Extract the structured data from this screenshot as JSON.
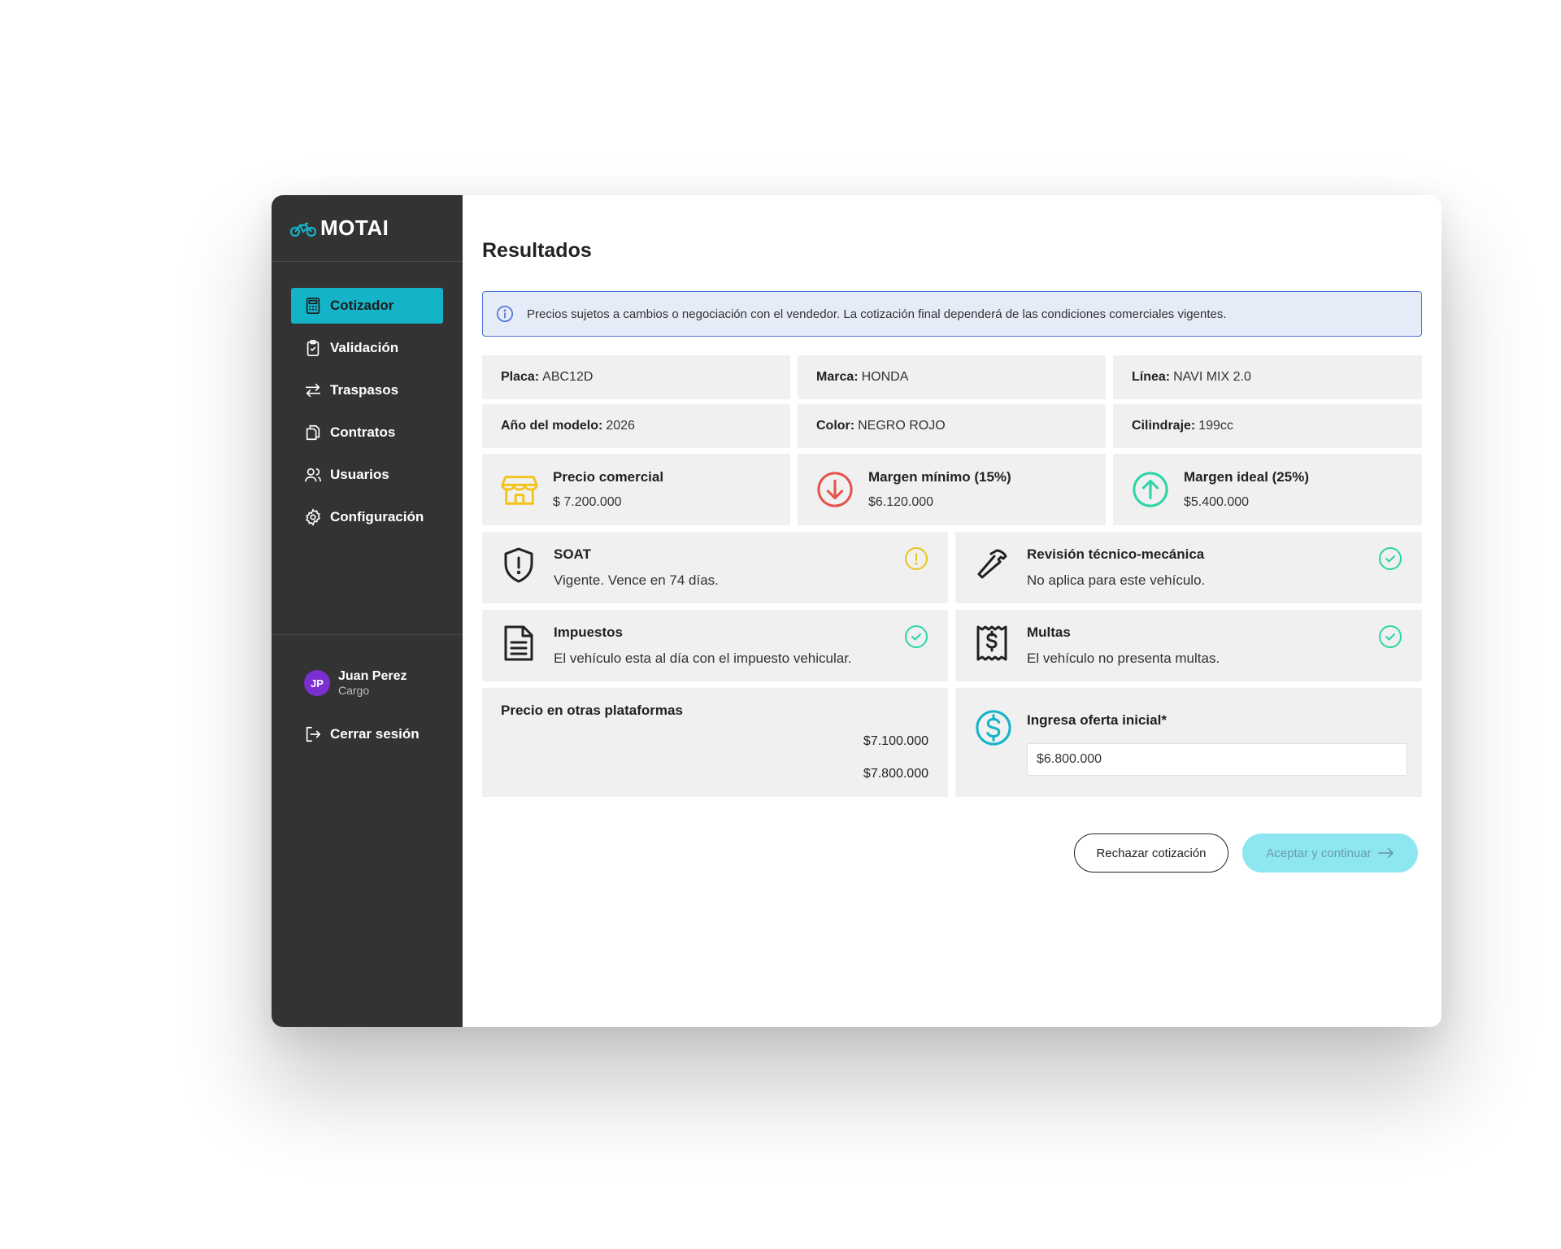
{
  "app": {
    "name": "MOTAI"
  },
  "sidebar": {
    "items": [
      {
        "label": "Cotizador",
        "active": true,
        "icon": "calculator-icon"
      },
      {
        "label": "Validación",
        "active": false,
        "icon": "clipboard-check-icon"
      },
      {
        "label": "Traspasos",
        "active": false,
        "icon": "arrows-swap-icon"
      },
      {
        "label": "Contratos",
        "active": false,
        "icon": "documents-icon"
      },
      {
        "label": "Usuarios",
        "active": false,
        "icon": "users-icon"
      },
      {
        "label": "Configuración",
        "active": false,
        "icon": "gear-icon"
      }
    ],
    "user": {
      "initials": "JP",
      "name": "Juan Perez",
      "role": "Cargo"
    },
    "logout_label": "Cerrar sesión"
  },
  "main": {
    "title": "Resultados",
    "alert": "Precios sujetos a cambios o negociación con el vendedor. La cotización final dependerá de las condiciones comerciales vigentes.",
    "vehicle": {
      "placa": {
        "label": "Placa:",
        "value": "ABC12D"
      },
      "marca": {
        "label": "Marca:",
        "value": "HONDA"
      },
      "linea": {
        "label": "Línea:",
        "value": "NAVI MIX 2.0"
      },
      "anio": {
        "label": "Año del modelo:",
        "value": "2026"
      },
      "color": {
        "label": "Color:",
        "value": "NEGRO ROJO"
      },
      "cilindraje": {
        "label": "Cilindraje:",
        "value": "199cc"
      }
    },
    "prices": {
      "comercial": {
        "title": "Precio comercial",
        "value": "$ 7.200.000"
      },
      "minimo": {
        "title": "Margen mínimo (15%)",
        "value": "$6.120.000"
      },
      "ideal": {
        "title": "Margen ideal (25%)",
        "value": "$5.400.000"
      }
    },
    "documents": {
      "soat": {
        "title": "SOAT",
        "text": "Vigente. Vence en 74 días.",
        "status": "warning"
      },
      "revision": {
        "title": "Revisión técnico-mecánica",
        "text": "No aplica para este vehículo.",
        "status": "ok"
      },
      "impuestos": {
        "title": "Impuestos",
        "text": "El vehículo esta al día con el impuesto vehicular.",
        "status": "ok"
      },
      "multas": {
        "title": "Multas",
        "text": "El vehículo no presenta multas.",
        "status": "ok"
      }
    },
    "platforms": {
      "title": "Precio en otras plataformas",
      "prices": [
        "$7.100.000",
        "$7.800.000"
      ]
    },
    "offer": {
      "label": "Ingresa oferta inicial*",
      "value": "$6.800.000"
    },
    "buttons": {
      "reject": "Rechazar cotización",
      "accept": "Aceptar y continuar"
    }
  },
  "colors": {
    "sidebar_bg": "#333333",
    "accent": "#14b3c8",
    "warning": "#e6c619",
    "success": "#2dd4a7",
    "danger": "#e5534b",
    "price_yellow": "#f2c318"
  }
}
